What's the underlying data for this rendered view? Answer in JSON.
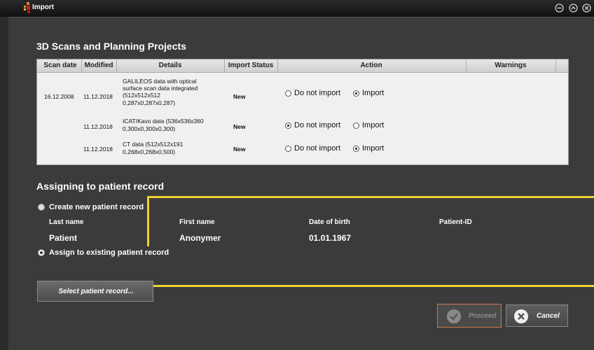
{
  "window": {
    "title": "Import"
  },
  "scans": {
    "title": "3D Scans and Planning Projects",
    "columns": [
      "Scan date",
      "Modified",
      "Details",
      "Import Status",
      "Action",
      "Warnings"
    ],
    "rows": [
      {
        "scan_date": "16.12.2008",
        "modified": "11.12.2018",
        "details": [
          "GALILEOS data with optical",
          "surface scan data integrated",
          "(512x512x512",
          "0,287x0,287x0,287)"
        ],
        "status": "New",
        "action": "import"
      },
      {
        "scan_date": "",
        "modified": "11.12.2018",
        "details": [
          "ICAT/Kavo data (536x536x360",
          "0,300x0,300x0,300)"
        ],
        "status": "New",
        "action": "do_not_import"
      },
      {
        "scan_date": "",
        "modified": "11.12.2018",
        "details": [
          "CT data (512x512x191",
          "0,268x0,268x0,500)"
        ],
        "status": "New",
        "action": "import"
      }
    ],
    "action_labels": {
      "do_not_import": "Do not import",
      "import": "Import"
    }
  },
  "patient": {
    "title": "Assigning to patient record",
    "create_new_label": "Create new patient record",
    "assign_existing_label": "Assign to existing patient record",
    "selected_option": "assign_existing",
    "headers": {
      "last_name": "Last name",
      "first_name": "First name",
      "dob": "Date of birth",
      "patient_id": "Patient-ID"
    },
    "values": {
      "last_name": "Patient",
      "first_name": "Anonymer",
      "dob": "01.01.1967",
      "patient_id": ""
    }
  },
  "buttons": {
    "select_record": "Select patient record...",
    "proceed": "Proceed",
    "cancel": "Cancel"
  },
  "colors": {
    "highlight": "#f0d030",
    "background": "#3b3b3b",
    "table_bg": "#f0f0f0"
  }
}
